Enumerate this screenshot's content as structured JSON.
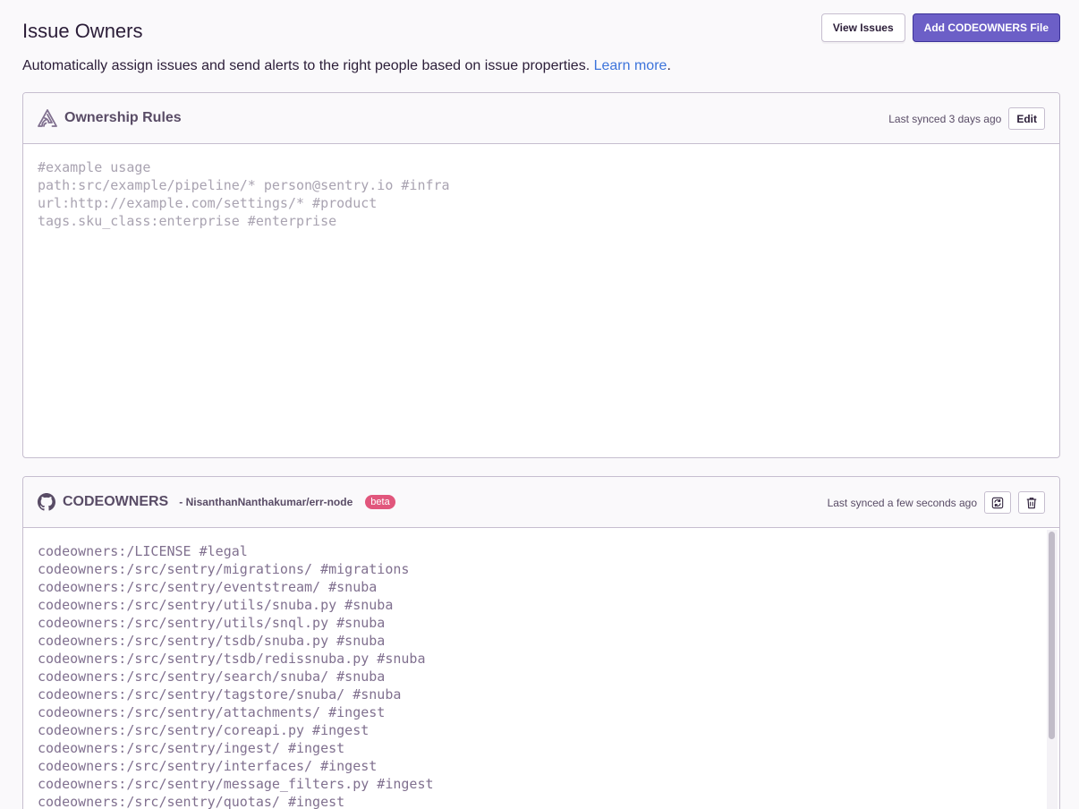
{
  "page": {
    "title": "Issue Owners",
    "description": "Automatically assign issues and send alerts to the right people based on issue properties.",
    "learn_more": "Learn more",
    "period": "."
  },
  "actions": {
    "view_issues": "View Issues",
    "add_codeowners": "Add CODEOWNERS File"
  },
  "ownership_rules": {
    "icon": "sentry-logo-icon",
    "title": "Ownership Rules",
    "last_synced": "Last synced 3 days ago",
    "edit_label": "Edit",
    "placeholder": "#example usage\npath:src/example/pipeline/* person@sentry.io #infra\nurl:http://example.com/settings/* #product\ntags.sku_class:enterprise #enterprise"
  },
  "codeowners": {
    "icon": "github-icon",
    "title": "CODEOWNERS",
    "repo": "- NisanthanNanthakumar/err-node",
    "badge": "beta",
    "last_synced": "Last synced a few seconds ago",
    "refresh_icon": "refresh-icon",
    "delete_icon": "trash-icon",
    "content": "codeowners:/LICENSE #legal\ncodeowners:/src/sentry/migrations/ #migrations\ncodeowners:/src/sentry/eventstream/ #snuba\ncodeowners:/src/sentry/utils/snuba.py #snuba\ncodeowners:/src/sentry/utils/snql.py #snuba\ncodeowners:/src/sentry/tsdb/snuba.py #snuba\ncodeowners:/src/sentry/tsdb/redissnuba.py #snuba\ncodeowners:/src/sentry/search/snuba/ #snuba\ncodeowners:/src/sentry/tagstore/snuba/ #snuba\ncodeowners:/src/sentry/attachments/ #ingest\ncodeowners:/src/sentry/coreapi.py #ingest\ncodeowners:/src/sentry/ingest/ #ingest\ncodeowners:/src/sentry/interfaces/ #ingest\ncodeowners:/src/sentry/message_filters.py #ingest\ncodeowners:/src/sentry/quotas/ #ingest"
  },
  "colors": {
    "primary": "#6c5fc7",
    "link": "#3d74db",
    "badge": "#e1567c"
  }
}
